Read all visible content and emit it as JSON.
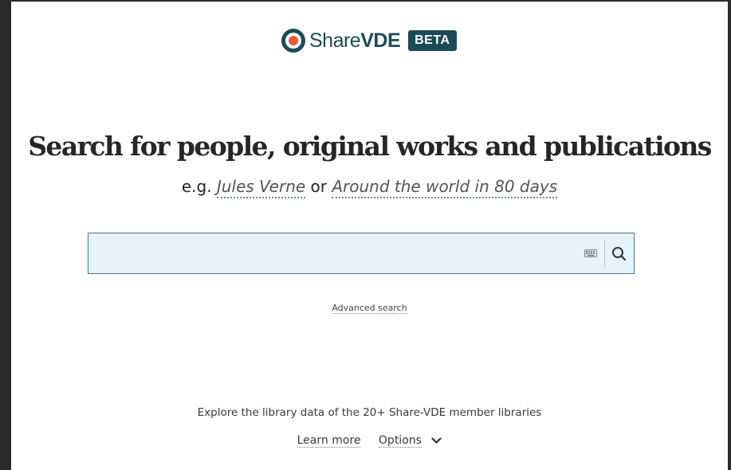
{
  "logo": {
    "word_light": "Share",
    "word_bold": "VDE",
    "badge": "BETA",
    "brand_color": "#1d4a57",
    "accent_color": "#e8583a"
  },
  "hero": {
    "title": "Search for people, original works and publications",
    "example_prefix": "e.g.",
    "example_1": "Jules Verne",
    "example_joiner": "or",
    "example_2": "Around the world in 80 days"
  },
  "search": {
    "placeholder": "",
    "value": "",
    "keyboard_icon": "keyboard-icon",
    "search_icon": "search-icon",
    "background": "#e6f3fb",
    "border": "#3f7a92"
  },
  "advanced_search": "Advanced search",
  "footer": {
    "explore_text": "Explore the library data of the 20+ Share-VDE member libraries",
    "learn_more": "Learn more",
    "options": "Options"
  }
}
